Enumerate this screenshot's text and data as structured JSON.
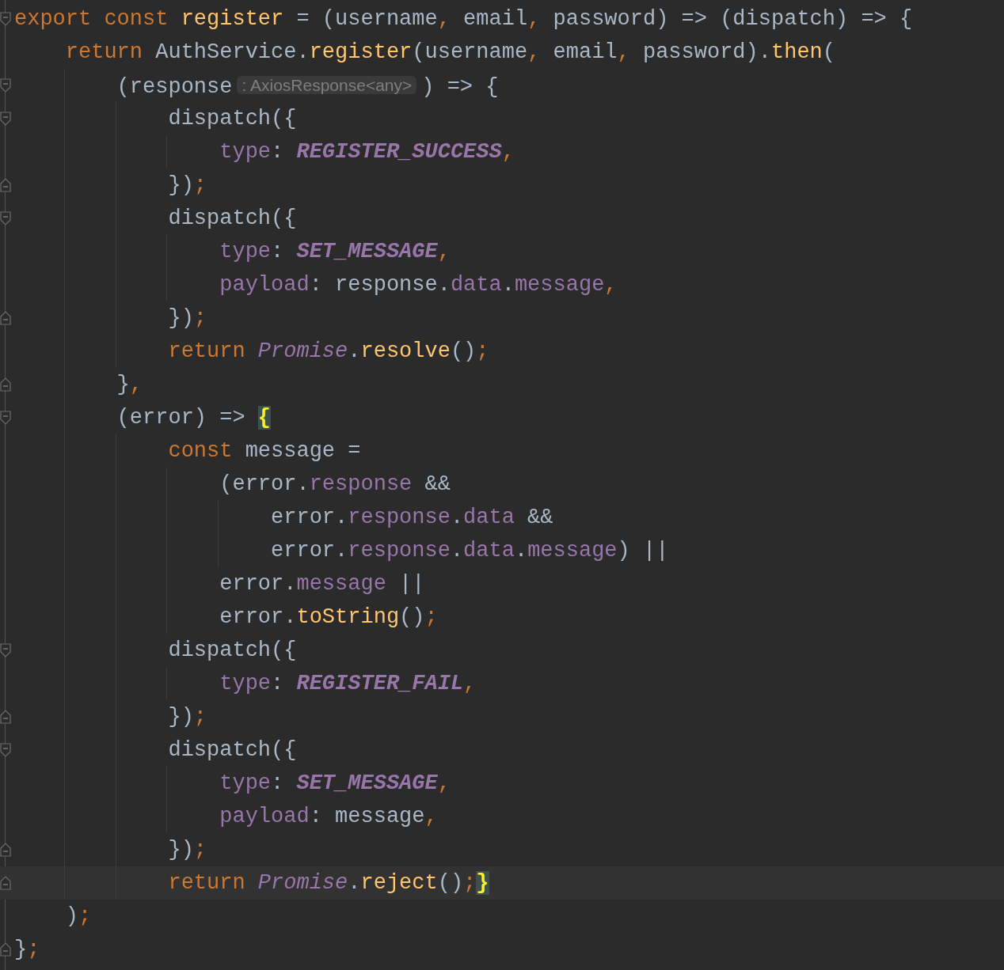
{
  "editor": {
    "lines": [
      {
        "current": false,
        "fold_start": true,
        "fold_end": false,
        "tokens": [
          {
            "kind": "kw",
            "text": "export const "
          },
          {
            "kind": "fn",
            "text": "register"
          },
          {
            "kind": "plain",
            "text": " = (username"
          },
          {
            "kind": "punct",
            "text": ","
          },
          {
            "kind": "plain",
            "text": " email"
          },
          {
            "kind": "punct",
            "text": ","
          },
          {
            "kind": "plain",
            "text": " password) => (dispatch) => {"
          }
        ]
      },
      {
        "current": false,
        "fold_start": false,
        "fold_end": false,
        "tokens": [
          {
            "kind": "kw",
            "text": "    return "
          },
          {
            "kind": "plain",
            "text": "AuthService."
          },
          {
            "kind": "fn",
            "text": "register"
          },
          {
            "kind": "plain",
            "text": "(username"
          },
          {
            "kind": "punct",
            "text": ","
          },
          {
            "kind": "plain",
            "text": " email"
          },
          {
            "kind": "punct",
            "text": ","
          },
          {
            "kind": "plain",
            "text": " password)."
          },
          {
            "kind": "fn",
            "text": "then"
          },
          {
            "kind": "plain",
            "text": "("
          }
        ]
      },
      {
        "current": false,
        "fold_start": true,
        "fold_end": false,
        "tokens": [
          {
            "kind": "plain",
            "text": "        (response"
          },
          {
            "kind": "hint",
            "text": ": AxiosResponse<any>"
          },
          {
            "kind": "plain",
            "text": ") => {"
          }
        ]
      },
      {
        "current": false,
        "fold_start": true,
        "fold_end": false,
        "tokens": [
          {
            "kind": "plain",
            "text": "            dispatch({"
          }
        ]
      },
      {
        "current": false,
        "fold_start": false,
        "fold_end": false,
        "tokens": [
          {
            "kind": "field",
            "text": "                type"
          },
          {
            "kind": "plain",
            "text": ": "
          },
          {
            "kind": "const",
            "text": "REGISTER_SUCCESS"
          },
          {
            "kind": "punct",
            "text": ","
          }
        ]
      },
      {
        "current": false,
        "fold_start": false,
        "fold_end": true,
        "tokens": [
          {
            "kind": "plain",
            "text": "            })"
          },
          {
            "kind": "punct",
            "text": ";"
          }
        ]
      },
      {
        "current": false,
        "fold_start": true,
        "fold_end": false,
        "tokens": [
          {
            "kind": "plain",
            "text": "            dispatch({"
          }
        ]
      },
      {
        "current": false,
        "fold_start": false,
        "fold_end": false,
        "tokens": [
          {
            "kind": "field",
            "text": "                type"
          },
          {
            "kind": "plain",
            "text": ": "
          },
          {
            "kind": "const",
            "text": "SET_MESSAGE"
          },
          {
            "kind": "punct",
            "text": ","
          }
        ]
      },
      {
        "current": false,
        "fold_start": false,
        "fold_end": false,
        "tokens": [
          {
            "kind": "field",
            "text": "                payload"
          },
          {
            "kind": "plain",
            "text": ": response."
          },
          {
            "kind": "field",
            "text": "data"
          },
          {
            "kind": "plain",
            "text": "."
          },
          {
            "kind": "field",
            "text": "message"
          },
          {
            "kind": "punct",
            "text": ","
          }
        ]
      },
      {
        "current": false,
        "fold_start": false,
        "fold_end": true,
        "tokens": [
          {
            "kind": "plain",
            "text": "            })"
          },
          {
            "kind": "punct",
            "text": ";"
          }
        ]
      },
      {
        "current": false,
        "fold_start": false,
        "fold_end": false,
        "tokens": [
          {
            "kind": "kw",
            "text": "            return "
          },
          {
            "kind": "class",
            "text": "Promise"
          },
          {
            "kind": "plain",
            "text": "."
          },
          {
            "kind": "fn",
            "text": "resolve"
          },
          {
            "kind": "plain",
            "text": "()"
          },
          {
            "kind": "punct",
            "text": ";"
          }
        ]
      },
      {
        "current": false,
        "fold_start": false,
        "fold_end": true,
        "tokens": [
          {
            "kind": "plain",
            "text": "        }"
          },
          {
            "kind": "punct",
            "text": ","
          }
        ]
      },
      {
        "current": false,
        "fold_start": true,
        "fold_end": false,
        "tokens": [
          {
            "kind": "plain",
            "text": "        (error) => "
          },
          {
            "kind": "brace",
            "text": "{"
          }
        ]
      },
      {
        "current": false,
        "fold_start": false,
        "fold_end": false,
        "tokens": [
          {
            "kind": "kw",
            "text": "            const "
          },
          {
            "kind": "plain",
            "text": "message ="
          }
        ]
      },
      {
        "current": false,
        "fold_start": false,
        "fold_end": false,
        "tokens": [
          {
            "kind": "plain",
            "text": "                (error."
          },
          {
            "kind": "field",
            "text": "response"
          },
          {
            "kind": "plain",
            "text": " &&"
          }
        ]
      },
      {
        "current": false,
        "fold_start": false,
        "fold_end": false,
        "tokens": [
          {
            "kind": "plain",
            "text": "                    error."
          },
          {
            "kind": "field",
            "text": "response"
          },
          {
            "kind": "plain",
            "text": "."
          },
          {
            "kind": "field",
            "text": "data"
          },
          {
            "kind": "plain",
            "text": " &&"
          }
        ]
      },
      {
        "current": false,
        "fold_start": false,
        "fold_end": false,
        "tokens": [
          {
            "kind": "plain",
            "text": "                    error."
          },
          {
            "kind": "field",
            "text": "response"
          },
          {
            "kind": "plain",
            "text": "."
          },
          {
            "kind": "field",
            "text": "data"
          },
          {
            "kind": "plain",
            "text": "."
          },
          {
            "kind": "field",
            "text": "message"
          },
          {
            "kind": "plain",
            "text": ") ||"
          }
        ]
      },
      {
        "current": false,
        "fold_start": false,
        "fold_end": false,
        "tokens": [
          {
            "kind": "plain",
            "text": "                error."
          },
          {
            "kind": "field",
            "text": "message"
          },
          {
            "kind": "plain",
            "text": " ||"
          }
        ]
      },
      {
        "current": false,
        "fold_start": false,
        "fold_end": false,
        "tokens": [
          {
            "kind": "plain",
            "text": "                error."
          },
          {
            "kind": "fn",
            "text": "toString"
          },
          {
            "kind": "plain",
            "text": "()"
          },
          {
            "kind": "punct",
            "text": ";"
          }
        ]
      },
      {
        "current": false,
        "fold_start": true,
        "fold_end": false,
        "tokens": [
          {
            "kind": "plain",
            "text": "            dispatch({"
          }
        ]
      },
      {
        "current": false,
        "fold_start": false,
        "fold_end": false,
        "tokens": [
          {
            "kind": "field",
            "text": "                type"
          },
          {
            "kind": "plain",
            "text": ": "
          },
          {
            "kind": "const",
            "text": "REGISTER_FAIL"
          },
          {
            "kind": "punct",
            "text": ","
          }
        ]
      },
      {
        "current": false,
        "fold_start": false,
        "fold_end": true,
        "tokens": [
          {
            "kind": "plain",
            "text": "            })"
          },
          {
            "kind": "punct",
            "text": ";"
          }
        ]
      },
      {
        "current": false,
        "fold_start": true,
        "fold_end": false,
        "tokens": [
          {
            "kind": "plain",
            "text": "            dispatch({"
          }
        ]
      },
      {
        "current": false,
        "fold_start": false,
        "fold_end": false,
        "tokens": [
          {
            "kind": "field",
            "text": "                type"
          },
          {
            "kind": "plain",
            "text": ": "
          },
          {
            "kind": "const",
            "text": "SET_MESSAGE"
          },
          {
            "kind": "punct",
            "text": ","
          }
        ]
      },
      {
        "current": false,
        "fold_start": false,
        "fold_end": false,
        "tokens": [
          {
            "kind": "field",
            "text": "                payload"
          },
          {
            "kind": "plain",
            "text": ": message"
          },
          {
            "kind": "punct",
            "text": ","
          }
        ]
      },
      {
        "current": false,
        "fold_start": false,
        "fold_end": true,
        "tokens": [
          {
            "kind": "plain",
            "text": "            })"
          },
          {
            "kind": "punct",
            "text": ";"
          }
        ]
      },
      {
        "current": true,
        "fold_start": false,
        "fold_end": true,
        "tokens": [
          {
            "kind": "kw",
            "text": "            return "
          },
          {
            "kind": "class",
            "text": "Promise"
          },
          {
            "kind": "plain",
            "text": "."
          },
          {
            "kind": "fn",
            "text": "reject"
          },
          {
            "kind": "plain",
            "text": "()"
          },
          {
            "kind": "punct",
            "text": ";"
          },
          {
            "kind": "brace",
            "text": "}"
          }
        ]
      },
      {
        "current": false,
        "fold_start": false,
        "fold_end": false,
        "tokens": [
          {
            "kind": "plain",
            "text": "    )"
          },
          {
            "kind": "punct",
            "text": ";"
          }
        ]
      },
      {
        "current": false,
        "fold_start": false,
        "fold_end": true,
        "tokens": [
          {
            "kind": "plain",
            "text": "}"
          },
          {
            "kind": "punct",
            "text": ";"
          }
        ]
      }
    ]
  }
}
